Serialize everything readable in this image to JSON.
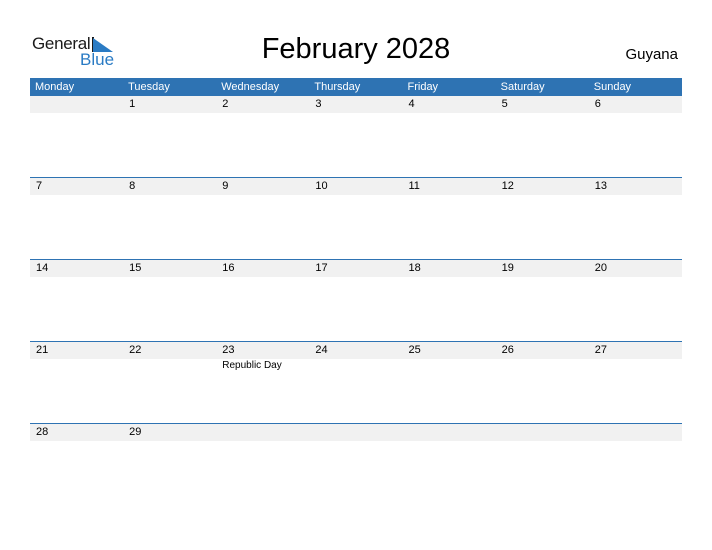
{
  "logo": {
    "word1": "General",
    "word2": "Blue"
  },
  "title": "February 2028",
  "country": "Guyana",
  "colors": {
    "header_bg": "#2e73b3",
    "row_bg": "#f1f1f1",
    "logo_blue": "#2a7bc4"
  },
  "weekdays": [
    "Monday",
    "Tuesday",
    "Wednesday",
    "Thursday",
    "Friday",
    "Saturday",
    "Sunday"
  ],
  "weeks": [
    {
      "days": [
        "",
        "1",
        "2",
        "3",
        "4",
        "5",
        "6"
      ],
      "events": [
        "",
        "",
        "",
        "",
        "",
        "",
        ""
      ]
    },
    {
      "days": [
        "7",
        "8",
        "9",
        "10",
        "11",
        "12",
        "13"
      ],
      "events": [
        "",
        "",
        "",
        "",
        "",
        "",
        ""
      ]
    },
    {
      "days": [
        "14",
        "15",
        "16",
        "17",
        "18",
        "19",
        "20"
      ],
      "events": [
        "",
        "",
        "",
        "",
        "",
        "",
        ""
      ]
    },
    {
      "days": [
        "21",
        "22",
        "23",
        "24",
        "25",
        "26",
        "27"
      ],
      "events": [
        "",
        "",
        "Republic Day",
        "",
        "",
        "",
        ""
      ]
    },
    {
      "days": [
        "28",
        "29",
        "",
        "",
        "",
        "",
        ""
      ],
      "events": [
        "",
        "",
        "",
        "",
        "",
        "",
        ""
      ]
    }
  ]
}
